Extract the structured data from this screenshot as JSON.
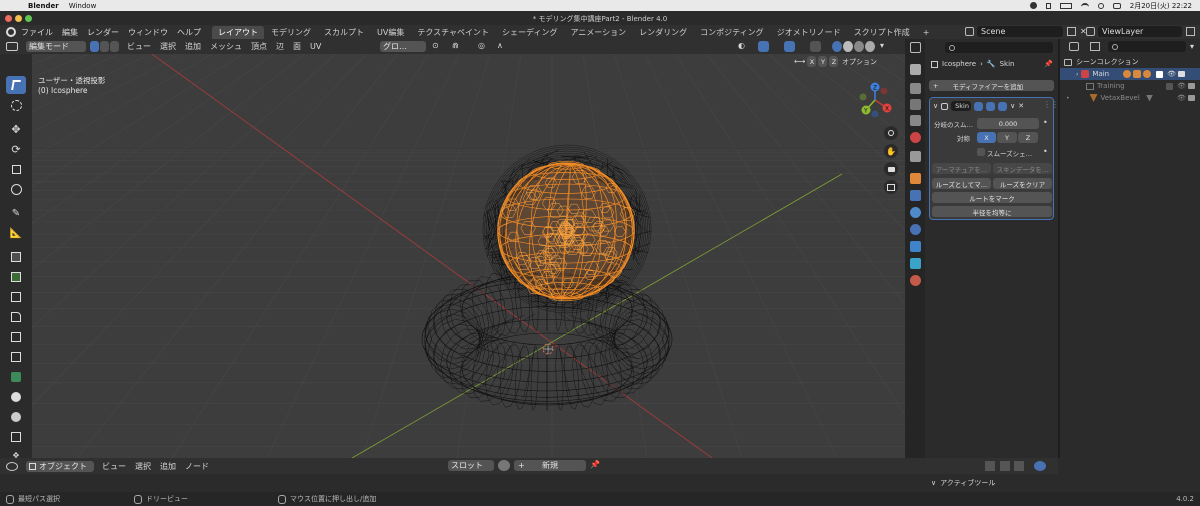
{
  "macbar": {
    "app": "Blender",
    "menu": [
      "Window"
    ],
    "clock": "2月20日(火)  22:22"
  },
  "window": {
    "title": "* モデリング集中講座Part2 - Blender 4.0"
  },
  "topbar": {
    "menus": [
      "ファイル",
      "編集",
      "レンダー",
      "ウィンドウ",
      "ヘルプ"
    ],
    "tabs": [
      "レイアウト",
      "モデリング",
      "スカルプト",
      "UV編集",
      "テクスチャペイント",
      "シェーディング",
      "アニメーション",
      "レンダリング",
      "コンポジティング",
      "ジオメトリノード",
      "スクリプト作成"
    ],
    "active_tab": "レイアウト",
    "add_tab": "+",
    "scene": "Scene",
    "view_layer": "ViewLayer"
  },
  "viewport_header": {
    "mode": "編集モード",
    "menus": [
      "ビュー",
      "選択",
      "追加",
      "メッシュ",
      "頂点",
      "辺",
      "面",
      "UV"
    ],
    "transform": "グロ…",
    "options": "オプション",
    "axes": [
      "X",
      "Y",
      "Z"
    ]
  },
  "viewport": {
    "view_name": "ユーザー・透視投影",
    "object_name": "(0) Icosphere"
  },
  "gizmo": {
    "x": "X",
    "y": "Y",
    "z": "Z"
  },
  "properties": {
    "breadcrumb_object": "Icosphere",
    "breadcrumb_sep": "›",
    "breadcrumb_modifier": "Skin",
    "add_modifier": "モディファイアーを追加",
    "modifier_name": "Skin",
    "branch_smooth_label": "分岐のスム…",
    "branch_smooth_value": "0.000",
    "symmetry_label": "対称",
    "symmetry_axes": [
      "X",
      "Y",
      "Z"
    ],
    "smooth_shading": "スムーズシェ…",
    "create_armature": "アーマチュアを…",
    "skin_data": "スキンデータを…",
    "mark_loose": "ルーズとしてマ…",
    "clear_loose": "ルーズをクリア",
    "mark_root": "ルートをマーク",
    "equalize_radii": "半径を均等に"
  },
  "outliner": {
    "root": "シーンコレクション",
    "items": [
      {
        "name": "Main"
      },
      {
        "name": "Training"
      },
      {
        "name": "VetaxBevel"
      }
    ]
  },
  "timeline": {
    "mode": "オブジェクト",
    "menus": [
      "ビュー",
      "選択",
      "追加",
      "ノード"
    ],
    "slot": "スロット",
    "new": "新規",
    "add": "+"
  },
  "active_tool_panel": "アクティブツール",
  "statusbar": {
    "select": "最短パス選択",
    "dolly": "ドリービュー",
    "cursor": "マウス位置に押し出し/追加",
    "version": "4.0.2"
  },
  "colors": {
    "accent": "#4772b3",
    "wire": "#0a0a0a",
    "selected_wire": "#f08a24",
    "x_axis": "#c83a3a",
    "y_axis": "#8dbb31",
    "viewport_bg": "#3d3d3d"
  }
}
